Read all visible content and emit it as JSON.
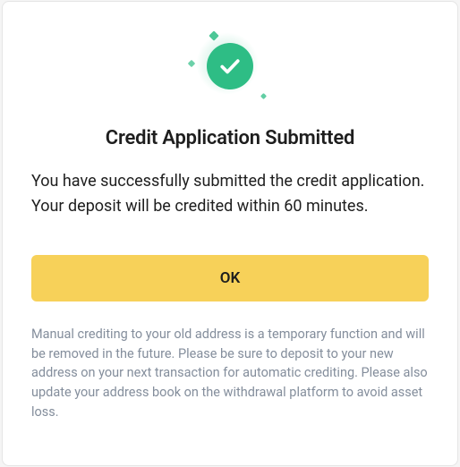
{
  "modal": {
    "icon": "check-success-icon",
    "title": "Credit Application Submitted",
    "message": "You have successfully submitted the credit application. Your deposit will be credited within 60 minutes.",
    "button_label": "OK",
    "disclaimer": "Manual crediting to your old address is a temporary function and will be removed in the future. Please be sure to deposit to your new address on your next transaction for automatic crediting. Please also update your address book on the withdrawal platform to avoid asset loss.",
    "colors": {
      "accent_success": "#2ebd85",
      "button_bg": "#f7d159",
      "text_primary": "#1e1e1e",
      "text_secondary": "#848e9c"
    }
  }
}
